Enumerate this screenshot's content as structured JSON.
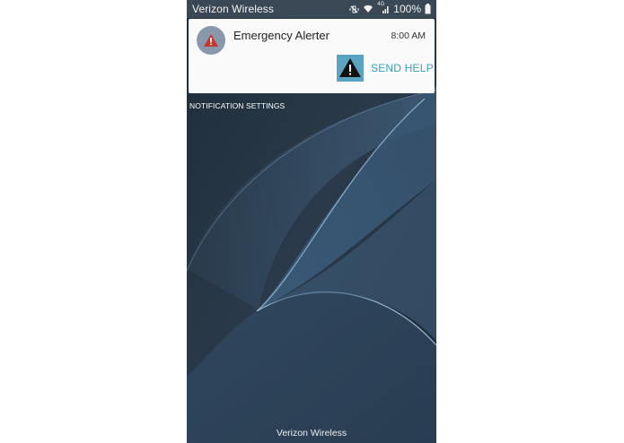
{
  "status_bar": {
    "carrier": "Verizon Wireless",
    "network": "4G",
    "battery_percent": "100%",
    "icons": [
      "mute-vibrate-icon",
      "wifi-icon",
      "lte-signal-icon",
      "battery-icon"
    ]
  },
  "notification": {
    "app_name": "Emergency Alerter",
    "time": "8:00 AM",
    "app_icon": "warning-icon",
    "action": {
      "label": "SEND HELP",
      "icon": "warning-icon"
    }
  },
  "notification_settings": {
    "label": "NOTIFICATION SETTINGS"
  },
  "lock_screen": {
    "carrier": "Verizon Wireless"
  },
  "colors": {
    "accent": "#3aa0b4",
    "action_icon_bg": "#5aa3c2",
    "warning_red": "#c0392b",
    "app_icon_bg": "#8a98ab"
  }
}
